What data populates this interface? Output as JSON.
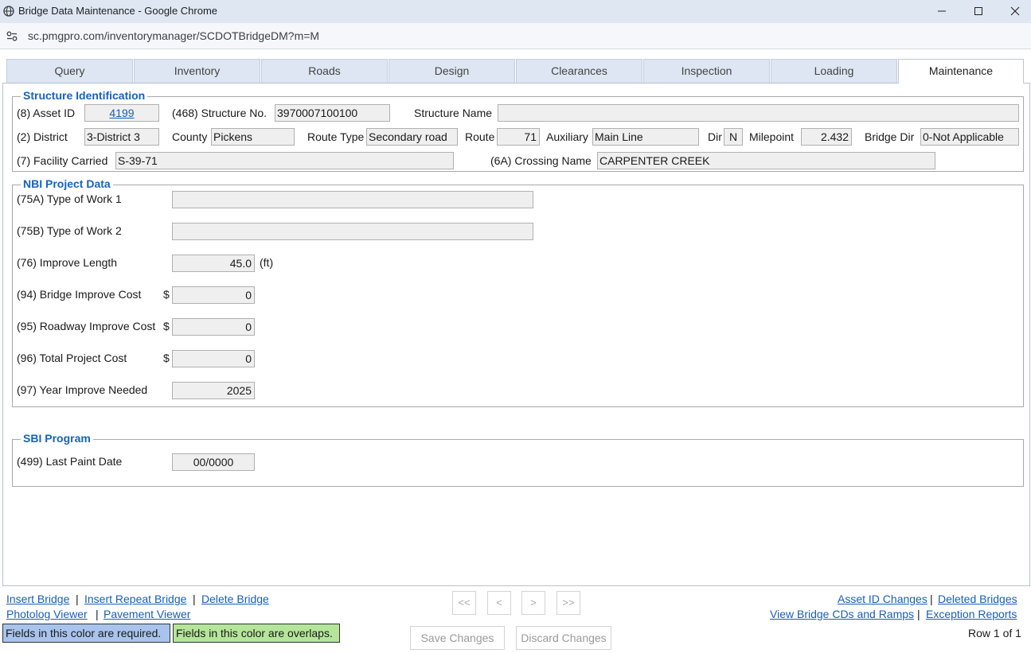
{
  "window": {
    "title": "Bridge Data Maintenance - Google Chrome",
    "url": "sc.pmgpro.com/inventorymanager/SCDOTBridgeDM?m=M"
  },
  "tabs": [
    "Query",
    "Inventory",
    "Roads",
    "Design",
    "Clearances",
    "Inspection",
    "Loading",
    "Maintenance"
  ],
  "active_tab": "Maintenance",
  "structure_identification": {
    "legend": "Structure Identification",
    "asset_id_label": "(8) Asset ID",
    "asset_id": "4199",
    "structure_no_label": "(468) Structure No.",
    "structure_no": "3970007100100",
    "structure_name_label": "Structure Name",
    "structure_name": "",
    "district_label": "(2) District",
    "district": "3-District 3",
    "county_label": "County",
    "county": "Pickens",
    "route_type_label": "Route Type",
    "route_type": "Secondary road",
    "route_label": "Route",
    "route": "71",
    "auxiliary_label": "Auxiliary",
    "auxiliary": "Main Line",
    "dir_label": "Dir",
    "dir": "N",
    "milepoint_label": "Milepoint",
    "milepoint": "2.432",
    "bridge_dir_label": "Bridge Dir",
    "bridge_dir": "0-Not Applicable",
    "facility_carried_label": "(7) Facility Carried",
    "facility_carried": "S-39-71",
    "crossing_name_label": "(6A) Crossing Name",
    "crossing_name": "CARPENTER CREEK"
  },
  "nbi_project": {
    "legend": "NBI Project Data",
    "type_of_work_1_label": "(75A) Type of Work 1",
    "type_of_work_1": "",
    "type_of_work_2_label": "(75B) Type of Work 2",
    "type_of_work_2": "",
    "improve_length_label": "(76) Improve Length",
    "improve_length": "45.0",
    "improve_length_unit": "(ft)",
    "bridge_improve_cost_label": "(94) Bridge Improve Cost",
    "bridge_improve_cost": "0",
    "roadway_improve_cost_label": "(95) Roadway Improve Cost",
    "roadway_improve_cost": "0",
    "total_project_cost_label": "(96) Total Project Cost",
    "total_project_cost": "0",
    "currency": "$",
    "year_improve_needed_label": "(97) Year Improve Needed",
    "year_improve_needed": "2025"
  },
  "sbi_program": {
    "legend": "SBI Program",
    "last_paint_date_label": "(499) Last Paint Date",
    "last_paint_date": "00/0000"
  },
  "footer": {
    "insert_bridge": "Insert Bridge",
    "insert_repeat_bridge": "Insert Repeat Bridge",
    "delete_bridge": "Delete Bridge",
    "photolog_viewer": "Photolog Viewer",
    "pavement_viewer": "Pavement Viewer",
    "separator": "|",
    "nav_first": "<<",
    "nav_prev": "<",
    "nav_next": ">",
    "nav_last": ">>",
    "save_changes": "Save Changes",
    "discard_changes": "Discard Changes",
    "asset_id_changes": "Asset ID Changes",
    "deleted_bridges": "Deleted Bridges",
    "view_bridge_cds": "View Bridge CDs and Ramps",
    "exception_reports": "Exception Reports",
    "legend_required": "Fields in this color are required.",
    "legend_overlaps": "Fields in this color are overlaps.",
    "row_info": "Row 1 of 1"
  },
  "colors": {
    "required": "#a9c4ec",
    "overlaps": "#b5e59a",
    "legend_text": "#1563c0",
    "link": "#1a5fb4"
  }
}
